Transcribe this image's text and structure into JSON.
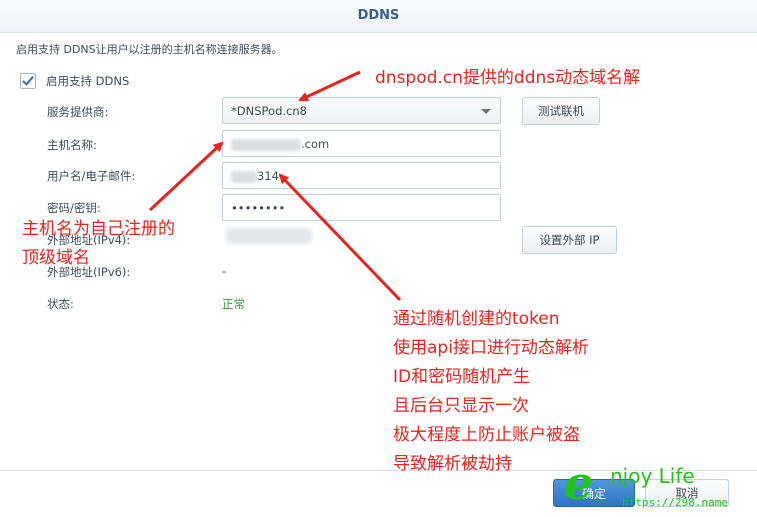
{
  "dialog": {
    "title": "DDNS",
    "description": "启用支持 DDNS让用户以注册的主机名称连接服务器。",
    "enable_checkbox": {
      "label": "启用支持 DDNS",
      "checked": true
    }
  },
  "form": {
    "provider": {
      "label": "服务提供商:",
      "value": "*DNSPod.cn8"
    },
    "hostname": {
      "label": "主机名称:",
      "value_suffix": ".com"
    },
    "username": {
      "label": "用户名/电子邮件:",
      "value_suffix": "314"
    },
    "password": {
      "label": "密码/密钥:",
      "value": "••••••••"
    },
    "ipv4": {
      "label": "外部地址(IPv4):"
    },
    "ipv6": {
      "label": "外部地址(IPv6):",
      "value": "-"
    },
    "status": {
      "label": "状态:",
      "value": "正常"
    }
  },
  "buttons": {
    "test": "测试联机",
    "set_external_ip": "设置外部 IP",
    "ok": "确定",
    "cancel": "取消"
  },
  "annotations": {
    "provider_note": "dnspod.cn提供的ddns动态域名解",
    "hostname_note_line1": "主机名为自己注册的",
    "hostname_note_line2": "顶级域名",
    "token_notes": [
      "通过随机创建的token",
      "使用api接口进行动态解析",
      "ID和密码随机产生",
      "且后台只显示一次",
      "极大程度上防止账户被盗",
      "导致解析被劫持"
    ]
  },
  "watermark": {
    "brand_letter": "e",
    "brand_text": "njoy Life",
    "url": "https://298.name"
  },
  "colors": {
    "annotation": "#e8241f",
    "status_ok": "#3a9a36",
    "primary": "#2f74c4",
    "watermark": "#22c417"
  }
}
